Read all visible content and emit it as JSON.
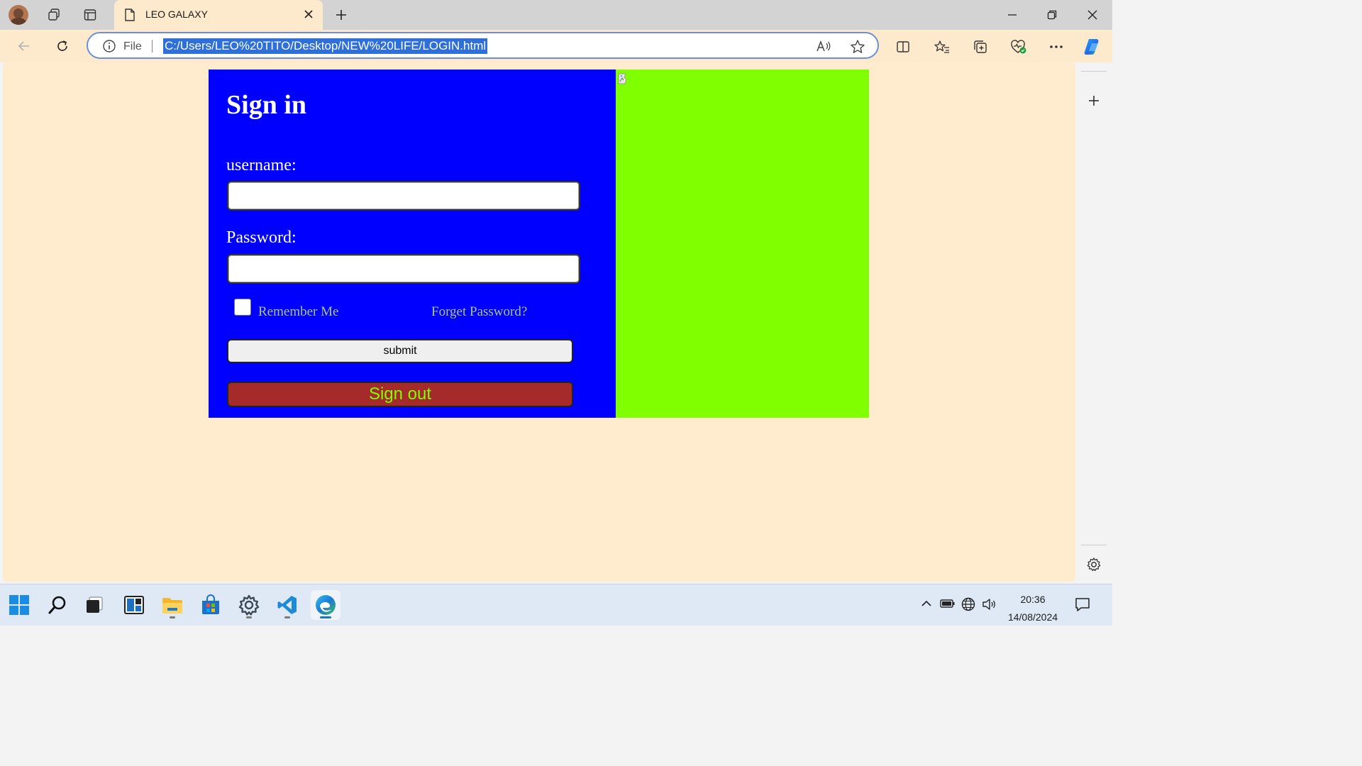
{
  "browser": {
    "tab": {
      "title": "LEO GALAXY",
      "icon": "document-icon"
    },
    "address_bar": {
      "scheme_label": "File",
      "url": "C:/Users/LEO%20TITO/Desktop/NEW%20LIFE/LOGIN.html"
    }
  },
  "page": {
    "background": "#ffebcd",
    "login_form": {
      "title": "Sign in",
      "username_label": "username:",
      "username_value": "",
      "password_label": "Password:",
      "password_value": "",
      "remember_label": "Remember Me",
      "remember_checked": false,
      "forgot_link": "Forget Password?",
      "submit_label": "submit",
      "signout_label": "Sign out",
      "panel_color": "#0000ff",
      "signout_color": "#a52a2a",
      "signout_text_color": "#7fff00"
    },
    "image_panel": {
      "color": "#7fff00",
      "image": "broken-image-icon"
    }
  },
  "taskbar": {
    "apps": [
      "windows-start",
      "search",
      "task-view",
      "widgets",
      "file-explorer",
      "microsoft-store",
      "settings",
      "vs-code",
      "microsoft-edge"
    ],
    "clock": {
      "time": "20:36",
      "date": "14/08/2024"
    }
  }
}
